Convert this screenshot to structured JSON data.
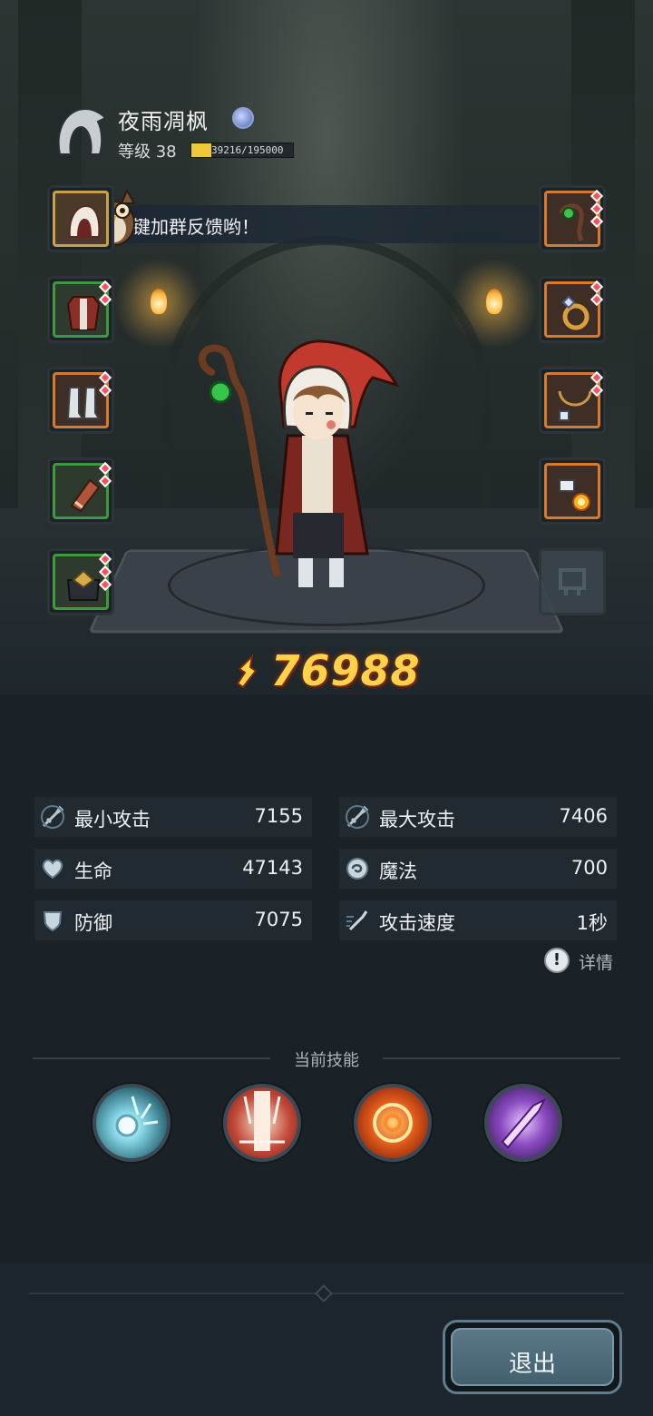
{
  "player": {
    "name": "夜雨凋枫",
    "level_label": "等级 38",
    "exp_text": "39216/195000",
    "exp_progress": 0.2
  },
  "notice": {
    "text": "键加群反馈哟！"
  },
  "equipment": {
    "left": [
      {
        "slot": "hood",
        "rarity": "gold",
        "gems": 0
      },
      {
        "slot": "robe",
        "rarity": "green",
        "gems": 2
      },
      {
        "slot": "boots",
        "rarity": "orange",
        "gems": 2
      },
      {
        "slot": "bracer",
        "rarity": "green",
        "gems": 2
      },
      {
        "slot": "belt",
        "rarity": "green",
        "gems": 3
      }
    ],
    "right": [
      {
        "slot": "staff",
        "rarity": "orange",
        "gems": 3
      },
      {
        "slot": "ring",
        "rarity": "orange",
        "gems": 2
      },
      {
        "slot": "necklace",
        "rarity": "orange",
        "gems": 2
      },
      {
        "slot": "charm",
        "rarity": "orange",
        "gems": 0
      },
      {
        "slot": "empty",
        "rarity": "empty",
        "gems": 0
      }
    ]
  },
  "power": {
    "value": "76988"
  },
  "stats": {
    "min_attack": {
      "label": "最小攻击",
      "value": "7155"
    },
    "max_attack": {
      "label": "最大攻击",
      "value": "7406"
    },
    "hp": {
      "label": "生命",
      "value": "47143"
    },
    "mp": {
      "label": "魔法",
      "value": "700"
    },
    "defense": {
      "label": "防御",
      "value": "7075"
    },
    "attack_speed": {
      "label": "攻击速度",
      "value": "1秒"
    }
  },
  "details_label": "详情",
  "skills": {
    "title": "当前技能",
    "items": [
      {
        "name": "frost-orb-icon",
        "color": "#7ecfe0"
      },
      {
        "name": "lightning-pillar-icon",
        "color": "#c44a3a"
      },
      {
        "name": "fire-vortex-icon",
        "color": "#e05a1a"
      },
      {
        "name": "shadow-blade-icon",
        "color": "#8a4ac0"
      }
    ]
  },
  "exit_label": "退出"
}
